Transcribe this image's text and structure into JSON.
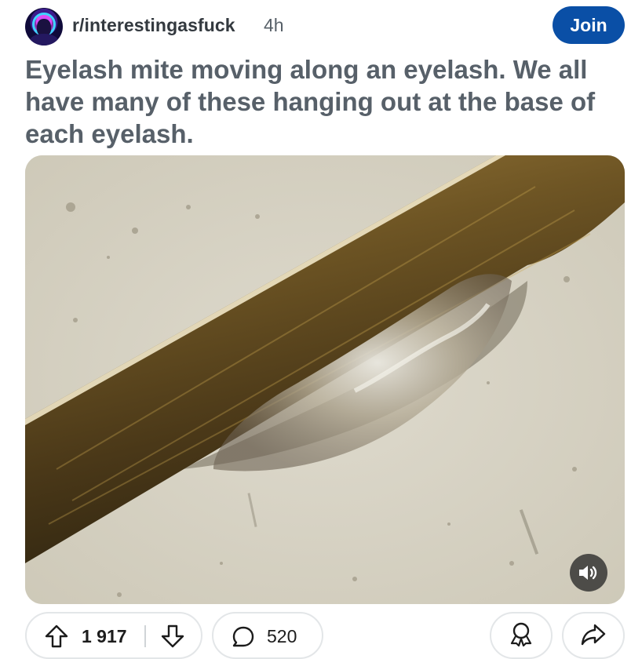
{
  "post": {
    "subreddit": "r/interestingasfuck",
    "age": "4h",
    "join_label": "Join",
    "title": "Eyelash mite moving along an eyelash. We all have many of these hanging out at the base of each eyelash."
  },
  "media": {
    "type": "video",
    "icon": "sound-on-icon"
  },
  "actions": {
    "upvote_icon": "upvote-arrow-icon",
    "score": "1 917",
    "downvote_icon": "downvote-arrow-icon",
    "comment_icon": "comment-bubble-icon",
    "comments": "520",
    "award_icon": "award-icon",
    "share_icon": "share-arrow-icon"
  },
  "colors": {
    "join_button": "#0a4fa6",
    "title_text": "#576069",
    "pill_border": "#e3e6e8"
  }
}
